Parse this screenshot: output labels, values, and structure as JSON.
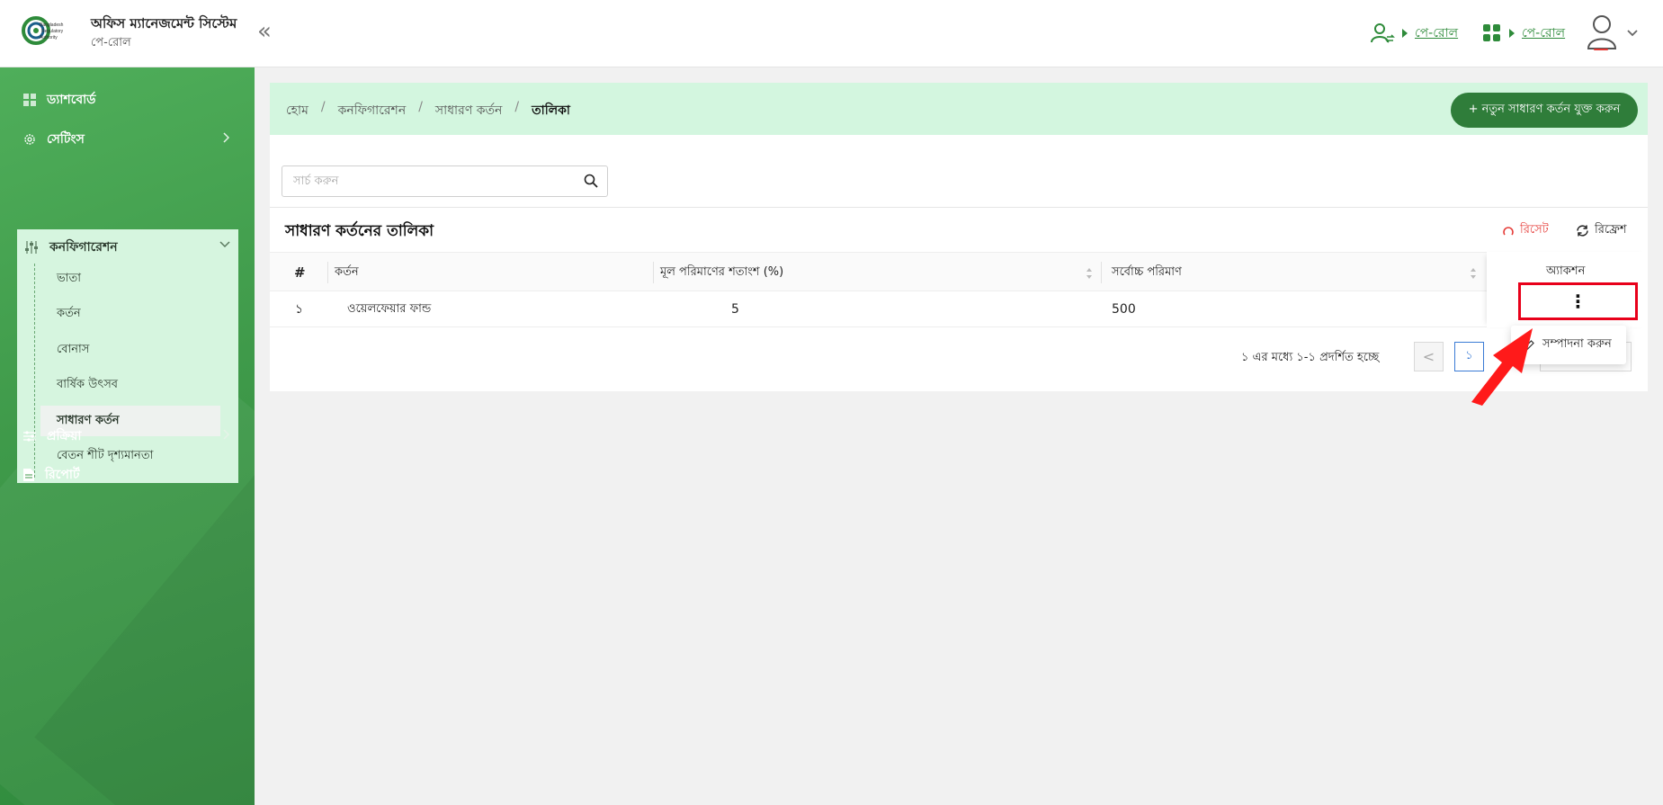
{
  "app": {
    "title": "অফিস ম্যানেজমেন্ট সিস্টেম",
    "subtitle": "পে-রোল",
    "logo_text": "Bangladesh Regulatory Authority"
  },
  "header": {
    "collapse_label": "«",
    "links": [
      {
        "label": "পে-রোল",
        "icon": "user-switch-icon"
      },
      {
        "label": "পে-রোল",
        "icon": "apps-grid-icon"
      }
    ],
    "accent_color": "#2e8b3a"
  },
  "sidebar": {
    "items": [
      {
        "label": "ড্যাশবোর্ড",
        "icon": "dashboard-icon"
      },
      {
        "label": "সেটিংস",
        "icon": "gear-icon"
      },
      {
        "label": "কনফিগারেশন",
        "icon": "sliders-icon"
      },
      {
        "label": "প্রক্রিয়া",
        "icon": "process-icon"
      },
      {
        "label": "রিপোর্ট",
        "icon": "document-icon"
      }
    ],
    "config_sub_items": [
      {
        "label": "ভাতা"
      },
      {
        "label": "কর্তন"
      },
      {
        "label": "বোনাস"
      },
      {
        "label": "বার্ষিক উৎসব"
      },
      {
        "label": "সাধারণ কর্তন"
      },
      {
        "label": "বেতন শীট দৃশ্যমানতা"
      }
    ],
    "active_item": "সাধারণ কর্তন"
  },
  "breadcrumb": {
    "items": [
      "হোম",
      "কনফিগারেশন",
      "সাধারণ কর্তন",
      "তালিকা"
    ],
    "separator": "/"
  },
  "add_button": {
    "label": "+ নতুন সাধারণ কর্তন যুক্ত করুন"
  },
  "search": {
    "placeholder": "সার্চ করুন",
    "value": ""
  },
  "table": {
    "title": "সাধারণ কর্তনের তালিকা",
    "reset_label": "রিসেট",
    "refresh_label": "রিফ্রেশ",
    "columns": [
      "#",
      "কর্তন",
      "মূল পরিমাণের শতাংশ (%)",
      "সর্বোচ্চ পরিমাণ",
      "অ্যাকশন"
    ],
    "rows": [
      {
        "index": "১",
        "name": "ওয়েলফেয়ার ফান্ড",
        "percent": "5",
        "max": "500"
      }
    ]
  },
  "pagination": {
    "info": "১ এর মধ্যে ১-১ প্রদর্শিত হচ্ছে",
    "current_page": "১",
    "prev_label": "<"
  },
  "action_menu": {
    "kebab": "⋮",
    "items": [
      {
        "label": "সম্পাদনা করুন",
        "icon": "edit-icon"
      }
    ]
  },
  "colors": {
    "sidebar_green": "#3f9a4a",
    "breadcrumb_bg": "#d3f6df",
    "button_green": "#2f7d3a",
    "highlight_red": "#e8001a",
    "reset_red": "#e53935",
    "pagination_blue": "#3a7bd5"
  }
}
